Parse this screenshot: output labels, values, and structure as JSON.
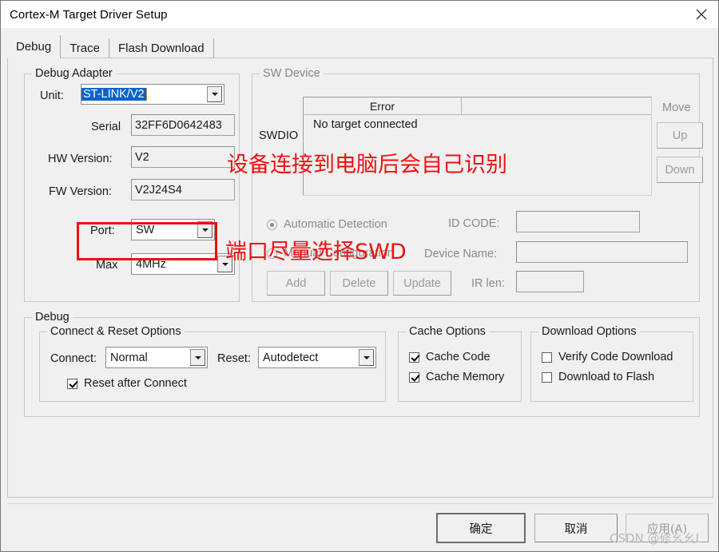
{
  "window": {
    "title": "Cortex-M Target Driver Setup",
    "close_icon": "close-icon"
  },
  "tabs": [
    {
      "label": "Debug",
      "active": true
    },
    {
      "label": "Trace",
      "active": false
    },
    {
      "label": "Flash Download",
      "active": false
    }
  ],
  "debug_adapter": {
    "legend": "Debug Adapter",
    "unit_label": "Unit:",
    "unit_value": "ST-LINK/V2",
    "serial_label": "Serial",
    "serial_value": "32FF6D0642483",
    "hw_version_label": "HW Version:",
    "hw_version_value": "V2",
    "fw_version_label": "FW Version:",
    "fw_version_value": "V2J24S4",
    "port_label": "Port:",
    "port_value": "SW",
    "max_label": "Max",
    "max_value": "4MHz"
  },
  "sw_device": {
    "legend": "SW Device",
    "swdio_label": "SWDIO",
    "table": {
      "headers": [
        "Error",
        ""
      ],
      "rows": [
        [
          "No target connected",
          ""
        ]
      ]
    },
    "move_label": "Move",
    "up_label": "Up",
    "down_label": "Down",
    "automatic_detection_label": "Automatic Detection",
    "manual_configuration_label": "Manual Configuration",
    "id_code_label": "ID CODE:",
    "id_code_value": "",
    "device_name_label": "Device Name:",
    "device_name_value": "",
    "ir_len_label": "IR len:",
    "ir_len_value": "",
    "add_label": "Add",
    "delete_label": "Delete",
    "update_label": "Update"
  },
  "debug_section": {
    "legend": "Debug",
    "connect_reset": {
      "legend": "Connect & Reset Options",
      "connect_label": "Connect:",
      "connect_value": "Normal",
      "reset_label": "Reset:",
      "reset_value": "Autodetect",
      "reset_after_connect_label": "Reset after Connect",
      "reset_after_connect_checked": true
    },
    "cache_options": {
      "legend": "Cache Options",
      "cache_code_label": "Cache Code",
      "cache_code_checked": true,
      "cache_memory_label": "Cache Memory",
      "cache_memory_checked": true
    },
    "download_options": {
      "legend": "Download Options",
      "verify_code_download_label": "Verify Code Download",
      "verify_code_download_checked": false,
      "download_to_flash_label": "Download to Flash",
      "download_to_flash_checked": false
    }
  },
  "footer": {
    "ok_label": "确定",
    "cancel_label": "取消",
    "apply_label": "应用(A)"
  },
  "annotations": [
    {
      "text": "设备连接到电脑后会自己识别"
    },
    {
      "text": "端口尽量选择SWD"
    }
  ],
  "watermark": "CSDN @修幺幺L",
  "colors": {
    "annotation_red": "#ee1111",
    "selection_blue": "#0a64c8",
    "dialog_bg": "#f0f0f0"
  }
}
